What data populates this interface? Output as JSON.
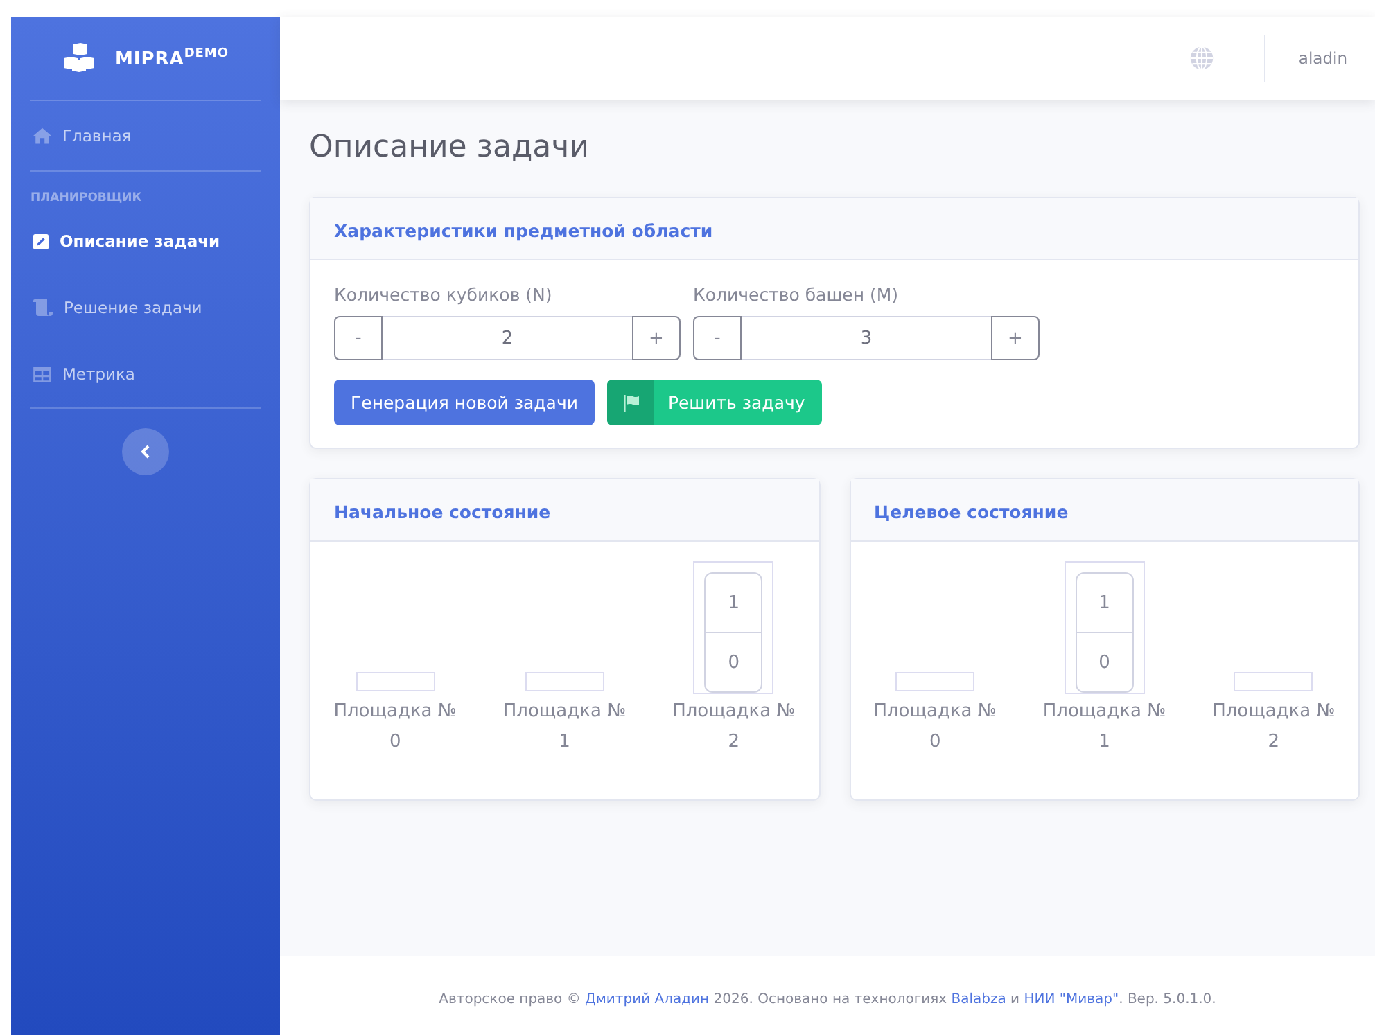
{
  "brand": {
    "name": "MIPRA",
    "sup": "DEMO"
  },
  "sidebar": {
    "items": [
      {
        "kind": "link",
        "label": "Главная",
        "selected": false
      },
      {
        "kind": "divider"
      },
      {
        "kind": "heading",
        "label": "ПЛАНИРОВЩИК"
      },
      {
        "kind": "link",
        "label": "Описание задачи",
        "selected": true
      },
      {
        "kind": "link",
        "label": "Решение задачи",
        "selected": false
      },
      {
        "kind": "link",
        "label": "Метрика",
        "selected": false
      },
      {
        "kind": "divider"
      }
    ]
  },
  "topbar": {
    "user": "aladin"
  },
  "page_title": "Описание задачи",
  "settings": {
    "title": "Характеристики предметной области",
    "steppers": [
      {
        "label": "Количество кубиков (N)",
        "minus": "-",
        "value": "2",
        "plus": "+"
      },
      {
        "label": "Количество башен (M)",
        "minus": "-",
        "value": "3",
        "plus": "+"
      }
    ],
    "buttons": [
      {
        "kind": "primary",
        "label": "Генерация новой задачи"
      },
      {
        "kind": "success",
        "label": "Решить задачу"
      }
    ]
  },
  "states": [
    {
      "title": "Начальное состояние",
      "platforms": [
        {
          "label": "Площадка №",
          "number": "0"
        },
        {
          "label": "Площадка №",
          "number": "1"
        },
        {
          "label": "Площадка №",
          "number": "2",
          "blocks": [
            "1",
            "0"
          ]
        }
      ]
    },
    {
      "title": "Целевое состояние",
      "platforms": [
        {
          "label": "Площадка №",
          "number": "0"
        },
        {
          "label": "Площадка №",
          "number": "1",
          "blocks": [
            "1",
            "0"
          ]
        },
        {
          "label": "Площадка №",
          "number": "2"
        }
      ]
    }
  ],
  "footer": [
    {
      "kind": "text",
      "text": "Авторское право ©"
    },
    {
      "kind": "link",
      "text": "Дмитрий Аладин"
    },
    {
      "kind": "text",
      "text": "2026. Основано на технологиях"
    },
    {
      "kind": "link",
      "text": "Balabza"
    },
    {
      "kind": "text",
      "text": "и"
    },
    {
      "kind": "link",
      "text": "НИИ \"Мивар\""
    },
    {
      "kind": "text",
      "text": ". Вер. 5.0.1.0."
    }
  ]
}
